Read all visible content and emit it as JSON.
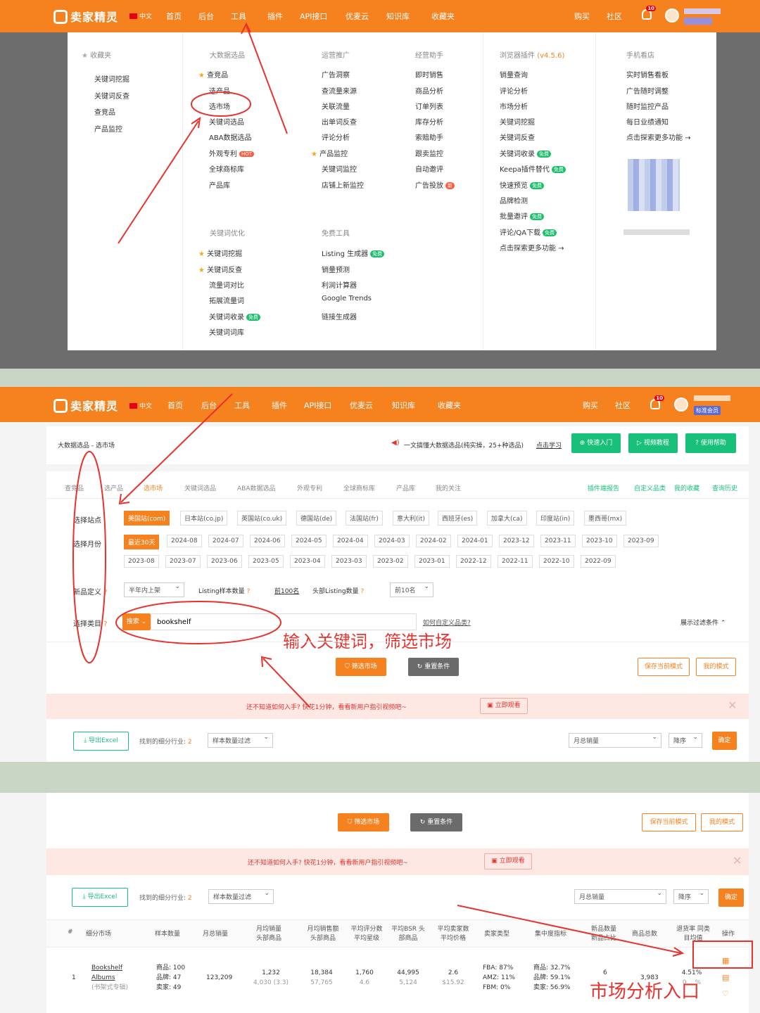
{
  "brand": {
    "name": "卖家精灵",
    "lang": "中文",
    "orange": "#f5821f",
    "green": "#18c07a",
    "red": "#e8322d"
  },
  "nav": [
    "首页",
    "后台",
    "工具",
    "插件",
    "API接口",
    "优麦云",
    "知识库",
    "收藏夹"
  ],
  "nav_right": [
    "购买",
    "社区"
  ],
  "bell_count": "10",
  "member": "标准会员",
  "dropdown": {
    "fav": {
      "title": "收藏夹",
      "items": [
        "关键词挖掘",
        "关键词反查",
        "查竞品",
        "产品监控"
      ]
    },
    "bigdata": {
      "title": "大数据选品",
      "items": [
        "查竞品",
        "选产品",
        "选市场",
        "关键词选品",
        "ABA数据选品",
        "外观专利",
        "全球商标库",
        "产品库"
      ],
      "hot": "HOT"
    },
    "kwopt": {
      "title": "关键词优化",
      "items": [
        "关键词挖掘",
        "关键词反查",
        "流量词对比",
        "拓展流量词",
        "关键词收录",
        "关键词词库"
      ]
    },
    "promo": {
      "title": "运营推广",
      "items": [
        "广告洞察",
        "查流量来源",
        "关联流量",
        "出单词反查",
        "评论分析",
        "产品监控",
        "关键词监控",
        "店铺上新监控"
      ]
    },
    "free": {
      "title": "免费工具",
      "items": [
        "Listing 生成器",
        "销量预测",
        "利润计算器",
        "Google Trends",
        "链接生成器"
      ]
    },
    "assist": {
      "title": "经营助手",
      "items": [
        "即时销售",
        "商品分析",
        "订单列表",
        "库存分析",
        "索赔助手",
        "跟卖监控",
        "自动邀评",
        "广告投放"
      ]
    },
    "plugin": {
      "title": "浏览器插件",
      "version": "(v4.5.6)",
      "items": [
        "销量查询",
        "评论分析",
        "市场分析",
        "关键词挖掘",
        "关键词反查",
        "关键词收录",
        "Keepa插件替代",
        "快速预览",
        "品牌检测",
        "批量邀评",
        "评论/QA下载"
      ],
      "more": "点击探索更多功能 →"
    },
    "mobile": {
      "title": "手机看店",
      "items": [
        "实时销售看板",
        "广告随时调整",
        "随时监控产品",
        "每日业绩通知"
      ],
      "more": "点击探索更多功能 →"
    },
    "badge_free": "免费",
    "badge_new": "新"
  },
  "panel2": {
    "breadcrumb": "大数据选品 - 选市场",
    "notice": "一文搞懂大数据选品(纯实操，25+种选品)",
    "learn": "点击学习",
    "help_buttons": [
      "快速入门",
      "视频教程",
      "使用帮助"
    ],
    "tabs": [
      "查竞品",
      "选产品",
      "选市场",
      "关键词选品",
      "ABA数据选品",
      "外观专利",
      "全球商标库",
      "产品库",
      "我的关注"
    ],
    "tabs_right": [
      "插件端报告",
      "自定义品类",
      "我的收藏",
      "查询历史"
    ],
    "site_label": "选择站点",
    "sites": [
      "美国站(com)",
      "日本站(co.jp)",
      "英国站(co.uk)",
      "德国站(de)",
      "法国站(fr)",
      "意大利(it)",
      "西班牙(es)",
      "加拿大(ca)",
      "印度站(in)",
      "墨西哥(mx)"
    ],
    "month_label": "选择月份",
    "months1": [
      "最近30天",
      "2024-08",
      "2024-07",
      "2024-06",
      "2024-05",
      "2024-04",
      "2024-03",
      "2024-02",
      "2024-01",
      "2023-12",
      "2023-11",
      "2023-10",
      "2023-09"
    ],
    "months2": [
      "2023-08",
      "2023-07",
      "2023-06",
      "2023-05",
      "2023-04",
      "2023-03",
      "2023-02",
      "2023-01",
      "2022-12",
      "2022-11",
      "2022-10",
      "2022-09"
    ],
    "newdef_label": "新品定义",
    "newdef_value": "半年内上架",
    "listing_label": "Listing样本数量",
    "listing_value": "前100名",
    "head_label": "头部Listing数量",
    "head_value": "前10名",
    "cat_label": "选择类目",
    "search_mode": "搜索",
    "keyword": "bookshelf",
    "custom_q": "如何自定义品类?",
    "show_filter": "展示过滤条件",
    "annotation": "输入关键词，筛选市场",
    "filter_btn": "筛选市场",
    "reset_btn": "重置条件",
    "save_btn": "保存当前模式",
    "mymode_btn": "我的模式",
    "warn_text": "还不知道如何入手? 快花1分钟，看看新用户指引视频吧~",
    "watch_btn": "立即观看",
    "export_btn": "导出Excel",
    "found": "找到的细分行业:",
    "found_count": "2",
    "sample_filter": "样本数量过滤",
    "sort_field": "月总销量",
    "sort_order": "降序",
    "confirm": "确定"
  },
  "panel3": {
    "annotation": "市场分析入口",
    "headers": [
      "#",
      "细分市场",
      "样本数量",
      "月总销量",
      "月均销量 头部商品",
      "月均销售额 头部商品",
      "平均评分数 平均星级",
      "平均BSR 头部商品",
      "平均卖家数 平均价格",
      "卖家类型",
      "集中度指标",
      "新品数量 新品占比",
      "商品总数",
      "退货率 同类目均值",
      "操作"
    ],
    "row": {
      "idx": "1",
      "market": "Bookshelf",
      "market2": "Albums",
      "market_cn": "(书架式专辑)",
      "sample": [
        "商品: 100",
        "品牌: 47",
        "卖家: 49"
      ],
      "total_sales": "123,209",
      "avg_sales": [
        "1,232",
        "4,030 (3.3)"
      ],
      "avg_revenue": [
        "18,384",
        "57,765"
      ],
      "avg_reviews": [
        "1,760",
        "4.6"
      ],
      "avg_bsr": [
        "44,995",
        "5,124"
      ],
      "avg_sellers": [
        "2.6",
        "$15.92"
      ],
      "seller_type": [
        "FBA: 87%",
        "AMZ: 11%",
        "FBM: 0%"
      ],
      "concentration": [
        "商品: 32.7%",
        "品牌: 59.1%",
        "卖家: 56.9%"
      ],
      "new_count": "6",
      "goods_total": "3,983",
      "return_rate": "4.51%",
      "return_avg": "0.…%"
    }
  }
}
